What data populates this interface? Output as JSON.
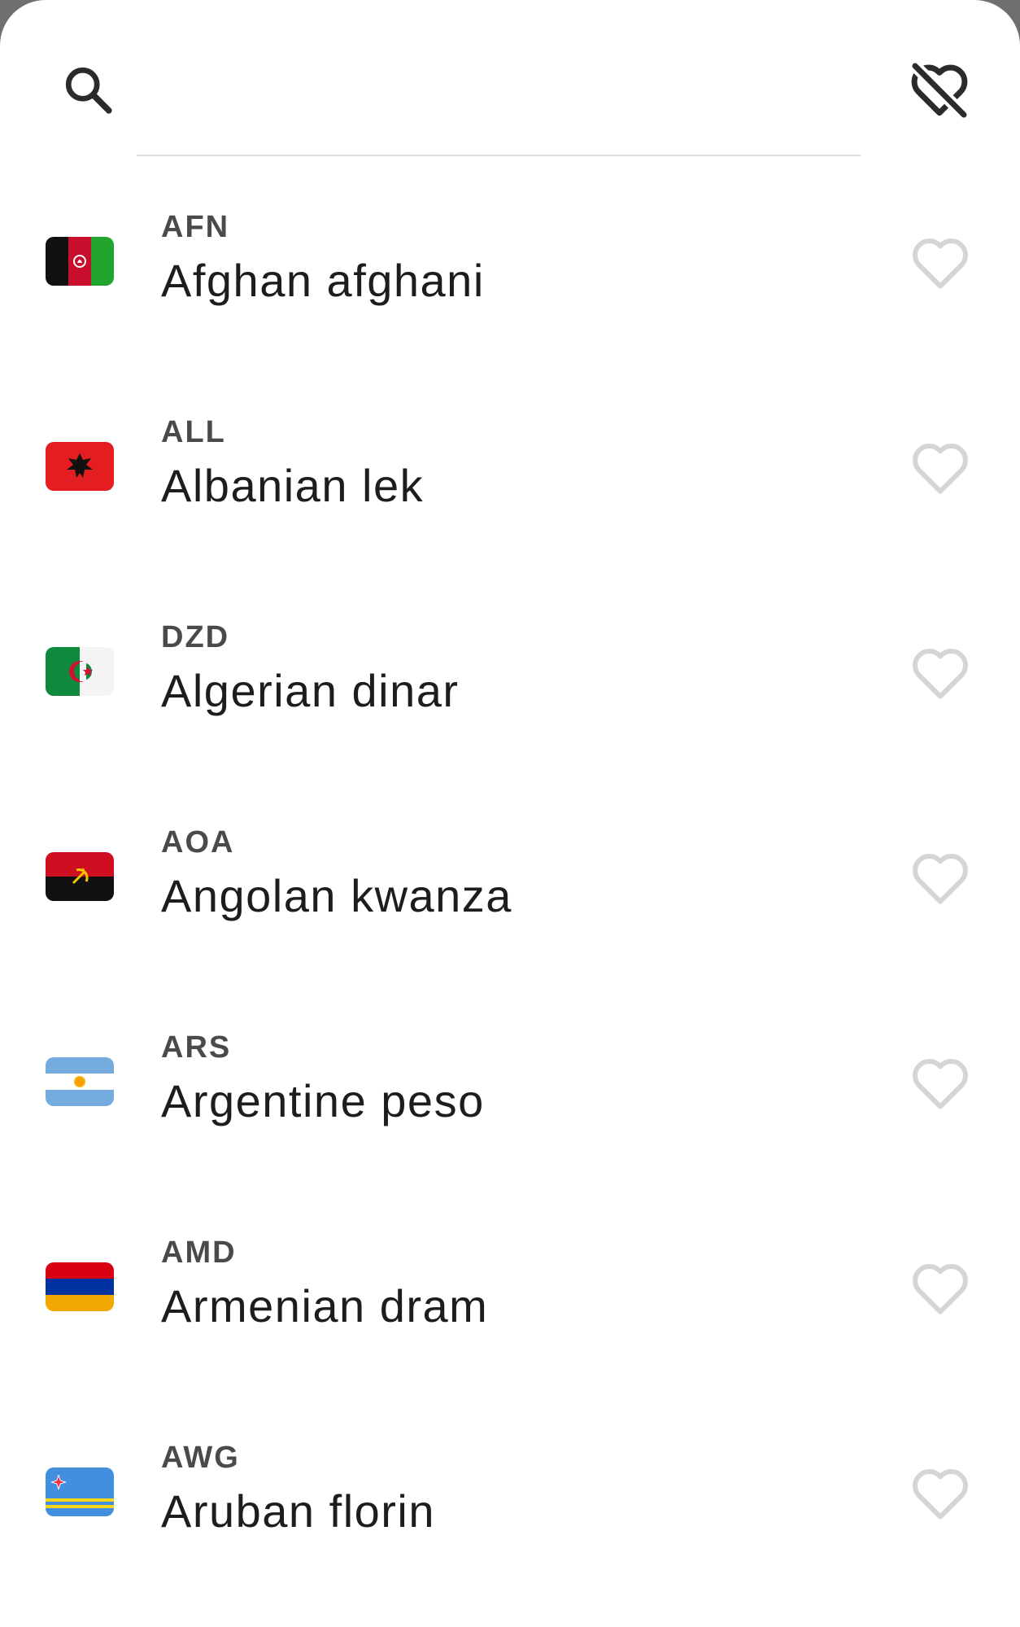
{
  "search": {
    "placeholder": "",
    "value": ""
  },
  "icons": {
    "search": "search-icon",
    "favorites_filter": "heart-off-icon",
    "favorite": "heart-outline-icon"
  },
  "colors": {
    "sheet_background": "#ffffff",
    "scrim": "#6f6f6f",
    "code_text": "#4a4a4a",
    "name_text": "#1d1d1d",
    "heart_outline": "#d5d5d5",
    "icon_dark": "#2b2b2b"
  },
  "currencies": [
    {
      "code": "AFN",
      "name": "Afghan afghani",
      "flag": "afghanistan-flag-icon",
      "favorite": false
    },
    {
      "code": "ALL",
      "name": "Albanian lek",
      "flag": "albania-flag-icon",
      "favorite": false
    },
    {
      "code": "DZD",
      "name": "Algerian dinar",
      "flag": "algeria-flag-icon",
      "favorite": false
    },
    {
      "code": "AOA",
      "name": "Angolan kwanza",
      "flag": "angola-flag-icon",
      "favorite": false
    },
    {
      "code": "ARS",
      "name": "Argentine peso",
      "flag": "argentina-flag-icon",
      "favorite": false
    },
    {
      "code": "AMD",
      "name": "Armenian dram",
      "flag": "armenia-flag-icon",
      "favorite": false
    },
    {
      "code": "AWG",
      "name": "Aruban florin",
      "flag": "aruba-flag-icon",
      "favorite": false
    }
  ]
}
